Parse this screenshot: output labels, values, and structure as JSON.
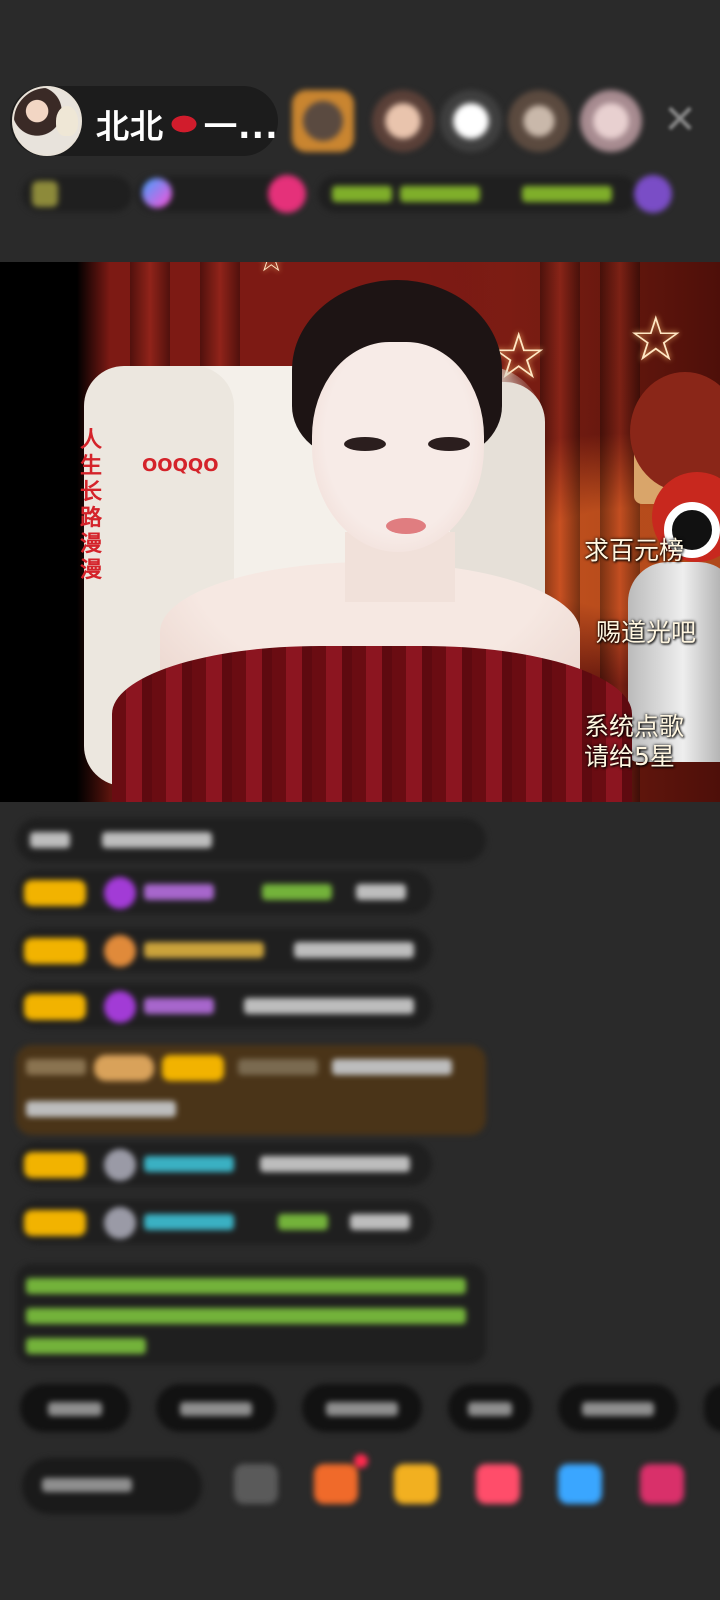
{
  "header": {
    "host_name_prefix": "北北",
    "host_name_suffix": "一...",
    "kiss_icon": "kiss-lips-emoji",
    "close_icon": "close-icon"
  },
  "video": {
    "side_text_left": "人生长路漫漫",
    "side_text_mid": "OOQQO",
    "overlay_1": "求百元榜",
    "overlay_2": "赐道光吧",
    "overlay_3_line1": "系统点歌",
    "overlay_3_line2": "请给5星"
  },
  "colors": {
    "background": "#2a2a2a",
    "badge_gold": "#f2b300",
    "overlay_red_text": "#d4232a"
  }
}
